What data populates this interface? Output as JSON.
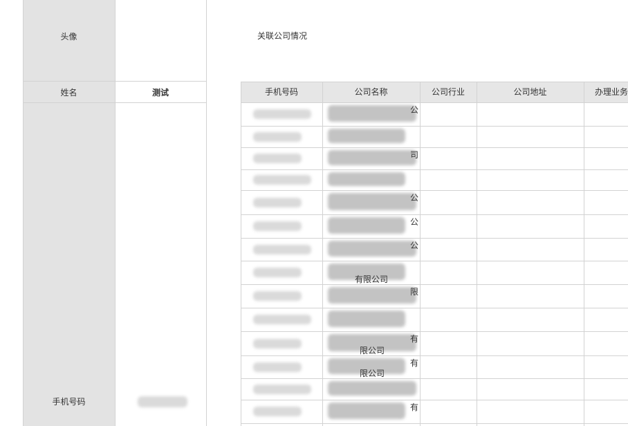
{
  "profile": {
    "avatar_label": "头像",
    "name_label": "姓名",
    "name_value": "测试",
    "phone_label": "手机号码"
  },
  "related": {
    "section_title": "关联公司情况",
    "columns": [
      "手机号码",
      "公司名称",
      "公司行业",
      "公司地址",
      "办理业务"
    ],
    "row_fragments": [
      [
        "",
        "公"
      ],
      [
        "",
        ""
      ],
      [
        "",
        "司"
      ],
      [
        "",
        ""
      ],
      [
        "公",
        ""
      ],
      [
        "公",
        ""
      ],
      [
        "公",
        ""
      ],
      [
        "有限公司",
        ""
      ],
      [
        "限",
        ""
      ],
      [
        "",
        ""
      ],
      [
        "有",
        "限公司"
      ],
      [
        "有",
        "限公司"
      ],
      [
        "",
        ""
      ],
      [
        "有",
        ""
      ]
    ]
  },
  "colors": {
    "label_bg": "#e3e3e3",
    "header_bg": "#e6e6e6",
    "border": "#d2d2d2"
  }
}
